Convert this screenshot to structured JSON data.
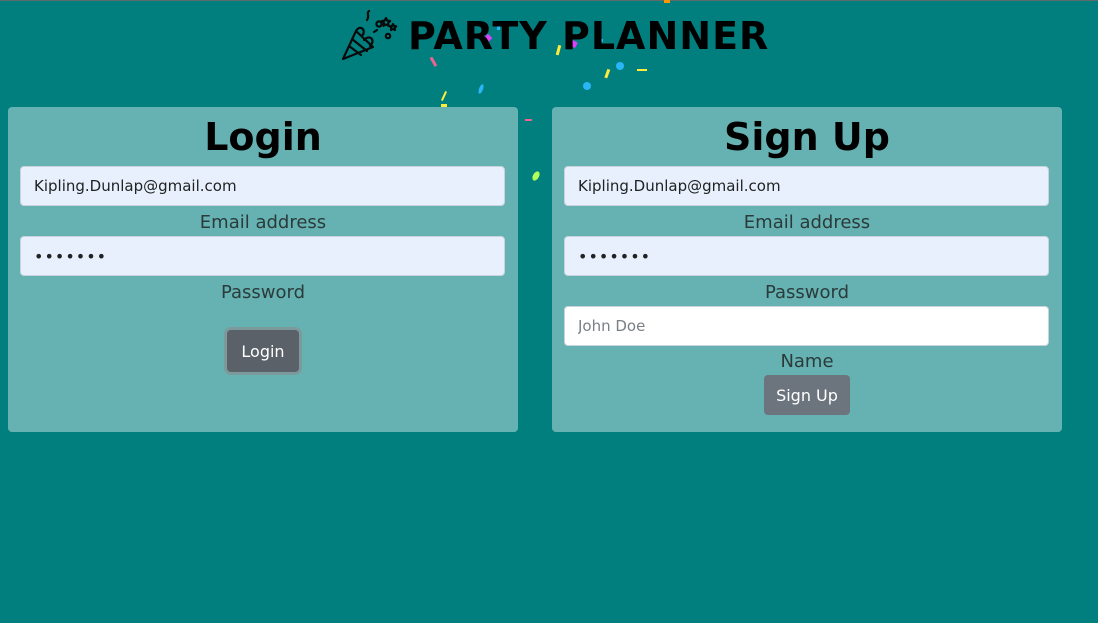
{
  "header": {
    "title": "PARTY PLANNER",
    "logo_icon": "party-popper-icon"
  },
  "login": {
    "title": "Login",
    "email_value": "Kipling.Dunlap@gmail.com",
    "email_label": "Email address",
    "password_value": "•••••••",
    "password_label": "Password",
    "button_label": "Login"
  },
  "signup": {
    "title": "Sign Up",
    "email_value": "Kipling.Dunlap@gmail.com",
    "email_label": "Email address",
    "password_value": "•••••••",
    "password_label": "Password",
    "name_placeholder": "John Doe",
    "name_label": "Name",
    "button_label": "Sign Up"
  },
  "colors": {
    "background": "#017f7f",
    "card": "#66b2b2",
    "autofill_field": "#e8f0fe",
    "button": "#6c757d"
  }
}
